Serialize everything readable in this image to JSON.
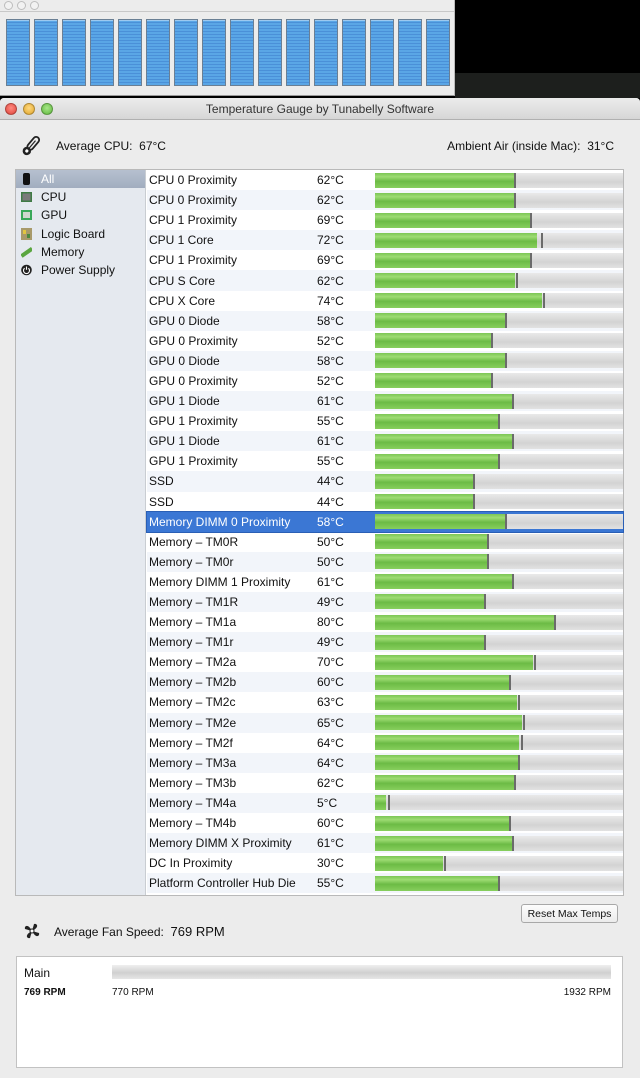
{
  "background_window": {
    "bar_count": 16
  },
  "window": {
    "title": "Temperature Gauge by Tunabelly Software"
  },
  "summary": {
    "average_cpu_label": "Average CPU:",
    "average_cpu_value": "67°C",
    "ambient_label": "Ambient Air (inside Mac):",
    "ambient_value": "31°C"
  },
  "sidebar": {
    "items": [
      {
        "label": "All",
        "icon": "mac-pro-icon",
        "selected": true
      },
      {
        "label": "CPU",
        "icon": "cpu-chip-icon",
        "selected": false
      },
      {
        "label": "GPU",
        "icon": "gpu-chip-icon",
        "selected": false
      },
      {
        "label": "Logic Board",
        "icon": "logic-board-icon",
        "selected": false
      },
      {
        "label": "Memory",
        "icon": "memory-stick-icon",
        "selected": false
      },
      {
        "label": "Power Supply",
        "icon": "power-icon",
        "selected": false
      }
    ]
  },
  "sensors": {
    "scale_max_c": 110,
    "colors": {
      "fill": "#7bc655",
      "selected_row": "#3b77d4"
    },
    "rows": [
      {
        "name": "CPU 0 Proximity",
        "temp": "62°C",
        "value": 62,
        "max": 62
      },
      {
        "name": "CPU 0 Proximity",
        "temp": "62°C",
        "value": 62,
        "max": 62
      },
      {
        "name": "CPU 1 Proximity",
        "temp": "69°C",
        "value": 69,
        "max": 69
      },
      {
        "name": "CPU 1 Core",
        "temp": "72°C",
        "value": 72,
        "max": 74
      },
      {
        "name": "CPU 1 Proximity",
        "temp": "69°C",
        "value": 69,
        "max": 69
      },
      {
        "name": "CPU S Core",
        "temp": "62°C",
        "value": 62,
        "max": 63
      },
      {
        "name": "CPU X Core",
        "temp": "74°C",
        "value": 74,
        "max": 75
      },
      {
        "name": "GPU 0 Diode",
        "temp": "58°C",
        "value": 58,
        "max": 58
      },
      {
        "name": "GPU 0 Proximity",
        "temp": "52°C",
        "value": 52,
        "max": 52
      },
      {
        "name": "GPU 0 Diode",
        "temp": "58°C",
        "value": 58,
        "max": 58
      },
      {
        "name": "GPU 0 Proximity",
        "temp": "52°C",
        "value": 52,
        "max": 52
      },
      {
        "name": "GPU 1 Diode",
        "temp": "61°C",
        "value": 61,
        "max": 61
      },
      {
        "name": "GPU 1 Proximity",
        "temp": "55°C",
        "value": 55,
        "max": 55
      },
      {
        "name": "GPU 1 Diode",
        "temp": "61°C",
        "value": 61,
        "max": 61
      },
      {
        "name": "GPU 1 Proximity",
        "temp": "55°C",
        "value": 55,
        "max": 55
      },
      {
        "name": "SSD",
        "temp": "44°C",
        "value": 44,
        "max": 44
      },
      {
        "name": "SSD",
        "temp": "44°C",
        "value": 44,
        "max": 44
      },
      {
        "name": "Memory DIMM 0 Proximity",
        "temp": "58°C",
        "value": 58,
        "max": 58,
        "selected": true
      },
      {
        "name": "Memory – TM0R",
        "temp": "50°C",
        "value": 50,
        "max": 50
      },
      {
        "name": "Memory – TM0r",
        "temp": "50°C",
        "value": 50,
        "max": 50
      },
      {
        "name": "Memory DIMM 1 Proximity",
        "temp": "61°C",
        "value": 61,
        "max": 61
      },
      {
        "name": "Memory – TM1R",
        "temp": "49°C",
        "value": 49,
        "max": 49
      },
      {
        "name": "Memory – TM1a",
        "temp": "80°C",
        "value": 80,
        "max": 80
      },
      {
        "name": "Memory – TM1r",
        "temp": "49°C",
        "value": 49,
        "max": 49
      },
      {
        "name": "Memory – TM2a",
        "temp": "70°C",
        "value": 70,
        "max": 71
      },
      {
        "name": "Memory – TM2b",
        "temp": "60°C",
        "value": 60,
        "max": 60
      },
      {
        "name": "Memory – TM2c",
        "temp": "63°C",
        "value": 63,
        "max": 64
      },
      {
        "name": "Memory – TM2e",
        "temp": "65°C",
        "value": 65,
        "max": 66
      },
      {
        "name": "Memory – TM2f",
        "temp": "64°C",
        "value": 64,
        "max": 65
      },
      {
        "name": "Memory – TM3a",
        "temp": "64°C",
        "value": 64,
        "max": 64
      },
      {
        "name": "Memory – TM3b",
        "temp": "62°C",
        "value": 62,
        "max": 62
      },
      {
        "name": "Memory – TM4a",
        "temp": "5°C",
        "value": 5,
        "max": 6
      },
      {
        "name": "Memory – TM4b",
        "temp": "60°C",
        "value": 60,
        "max": 60
      },
      {
        "name": "Memory DIMM X Proximity",
        "temp": "61°C",
        "value": 61,
        "max": 61
      },
      {
        "name": "DC In Proximity",
        "temp": "30°C",
        "value": 30,
        "max": 31
      },
      {
        "name": "Platform Controller Hub Die",
        "temp": "55°C",
        "value": 55,
        "max": 55
      }
    ]
  },
  "buttons": {
    "reset_max_temps": "Reset Max Temps"
  },
  "fans": {
    "average_label": "Average Fan Speed:",
    "average_value": "769 RPM",
    "items": [
      {
        "name": "Main",
        "current": "769 RPM",
        "min": "770 RPM",
        "max": "1932 RPM",
        "current_rpm": 769,
        "min_rpm": 770,
        "max_rpm": 1932
      }
    ]
  }
}
